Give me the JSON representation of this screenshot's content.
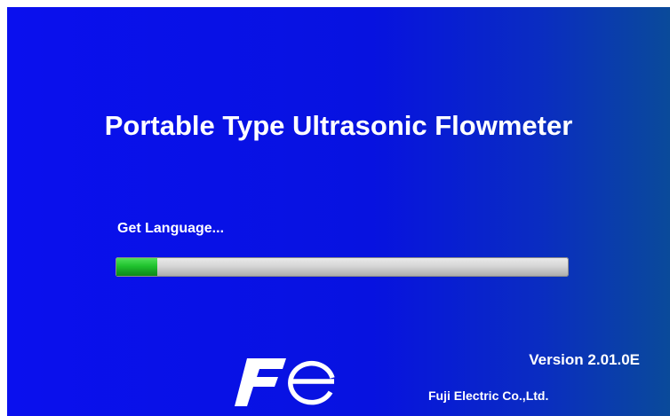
{
  "splash": {
    "title": "Portable Type Ultrasonic Flowmeter",
    "status_text": "Get Language...",
    "progress_fraction": 0.09,
    "version": "Version 2.01.0E",
    "company": "Fuji Electric Co.,Ltd.",
    "logo_text": "Fe",
    "logo_icon": "fuji-electric-logo-icon"
  },
  "colors": {
    "background": "#0712e0",
    "text": "#ffffff",
    "progress_fill": "#1fc22e",
    "progress_track": "#d6d6d6"
  }
}
